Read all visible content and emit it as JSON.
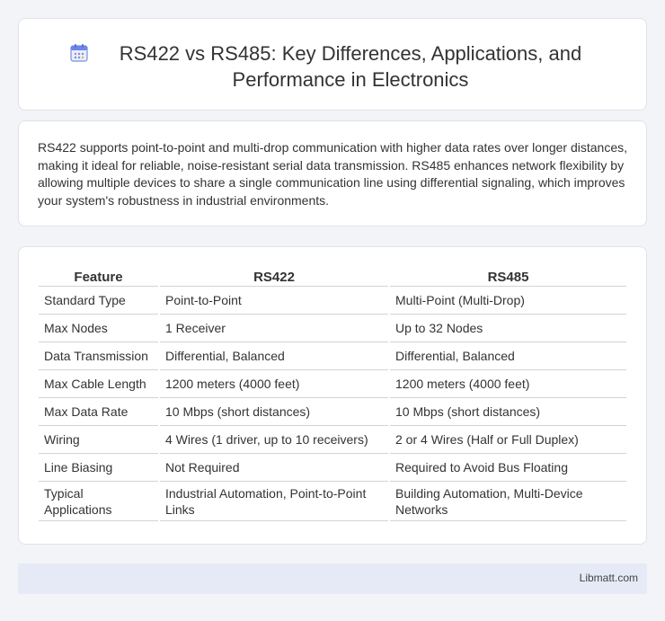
{
  "header": {
    "title": "RS422 vs RS485: Key Differences, Applications, and Performance in Electronics",
    "icon": "calendar-icon"
  },
  "intro": {
    "text": "RS422 supports point-to-point and multi-drop communication with higher data rates over longer distances, making it ideal for reliable, noise-resistant serial data transmission. RS485 enhances network flexibility by allowing multiple devices to share a single communication line using differential signaling, which improves your system's robustness in industrial environments."
  },
  "table": {
    "headers": [
      "Feature",
      "RS422",
      "RS485"
    ],
    "rows": [
      [
        "Standard Type",
        "Point-to-Point",
        "Multi-Point (Multi-Drop)"
      ],
      [
        "Max Nodes",
        "1 Receiver",
        "Up to 32 Nodes"
      ],
      [
        "Data Transmission",
        "Differential, Balanced",
        "Differential, Balanced"
      ],
      [
        "Max Cable Length",
        "1200 meters (4000 feet)",
        "1200 meters (4000 feet)"
      ],
      [
        "Max Data Rate",
        "10 Mbps (short distances)",
        "10 Mbps (short distances)"
      ],
      [
        "Wiring",
        "4 Wires (1 driver, up to 10 receivers)",
        "2 or 4 Wires (Half or Full Duplex)"
      ],
      [
        "Line Biasing",
        "Not Required",
        "Required to Avoid Bus Floating"
      ],
      [
        "Typical Applications",
        "Industrial Automation, Point-to-Point Links",
        "Building Automation, Multi-Device Networks"
      ]
    ]
  },
  "footer": {
    "brand": "Libmatt.com"
  }
}
